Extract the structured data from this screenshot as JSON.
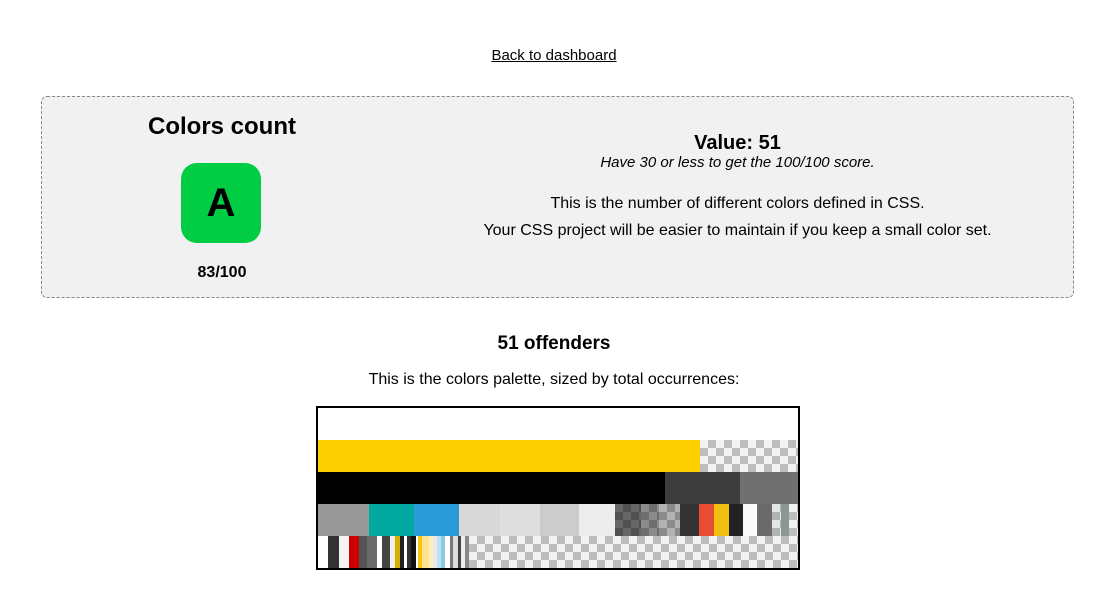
{
  "nav": {
    "back_label": "Back to dashboard"
  },
  "rule": {
    "title": "Colors count",
    "grade": "A",
    "score": "83/100",
    "grade_color": "#00cc44",
    "value_text": "Value: 51",
    "hint": "Have 30 or less to get the 100/100 score.",
    "description_line1": "This is the number of different colors defined in CSS.",
    "description_line2": "Your CSS project will be easier to maintain if you keep a small color set."
  },
  "offenders": {
    "title": "51 offenders",
    "caption": "This is the colors palette, sized by total occurrences:",
    "palette_rows": [
      [
        {
          "color": "#ffffff",
          "weight": 480
        }
      ],
      [
        {
          "color": "#ffd000",
          "weight": 382
        },
        {
          "color": "rgba(0,0,0,0.05)",
          "weight": 98,
          "transparent": true
        }
      ],
      [
        {
          "color": "#000000",
          "weight": 347
        },
        {
          "color": "#3c3c3c",
          "weight": 75
        },
        {
          "color": "#707070",
          "weight": 58
        }
      ],
      [
        {
          "color": "#999999",
          "weight": 50
        },
        {
          "color": "#00a8a0",
          "weight": 45
        },
        {
          "color": "#2a9ad8",
          "weight": 45
        },
        {
          "color": "#d8d8d8",
          "weight": 40
        },
        {
          "color": "#dedede",
          "weight": 40
        },
        {
          "color": "#cccccc",
          "weight": 38
        },
        {
          "color": "#ececec",
          "weight": 36
        },
        {
          "color": "rgba(0,0,0,0.6)",
          "weight": 26,
          "transparent": true
        },
        {
          "color": "rgba(0,0,0,0.45)",
          "weight": 18,
          "transparent": true
        },
        {
          "color": "rgba(0,0,0,0.3)",
          "weight": 20,
          "transparent": true
        },
        {
          "color": "#333333",
          "weight": 19
        },
        {
          "color": "#e94b35",
          "weight": 15
        },
        {
          "color": "#f0c010",
          "weight": 15
        },
        {
          "color": "#222222",
          "weight": 14
        },
        {
          "color": "#fafafa",
          "weight": 13
        },
        {
          "color": "#ffffff",
          "weight": 1
        },
        {
          "color": "#6a6a6a",
          "weight": 14
        },
        {
          "color": "rgba(0,0,0,0.1)",
          "weight": 9,
          "transparent": true
        },
        {
          "color": "#8a9a90",
          "weight": 8
        },
        {
          "color": "rgba(0,0,0,0.05)",
          "weight": 9,
          "transparent": true
        }
      ],
      [
        {
          "color": "#ffffff",
          "weight": 10
        },
        {
          "color": "#333333",
          "weight": 10
        },
        {
          "color": "#f4f4f4",
          "weight": 10
        },
        {
          "color": "#cc0000",
          "weight": 9
        },
        {
          "color": "#555555",
          "weight": 8
        },
        {
          "color": "#6a6a6a",
          "weight": 9
        },
        {
          "color": "#ffffff",
          "weight": 5
        },
        {
          "color": "#444444",
          "weight": 8
        },
        {
          "color": "#f0f0f0",
          "weight": 5
        },
        {
          "color": "#d4b000",
          "weight": 4
        },
        {
          "color": "#222222",
          "weight": 4
        },
        {
          "color": "#ffffff",
          "weight": 3
        },
        {
          "color": "#333333",
          "weight": 4
        },
        {
          "color": "#111111",
          "weight": 5
        },
        {
          "color": "#ffffff",
          "weight": 2
        },
        {
          "color": "#f5c518",
          "weight": 4
        },
        {
          "color": "#ffe28a",
          "weight": 5
        },
        {
          "color": "#ffeebb",
          "weight": 5
        },
        {
          "color": "#e8e8e8",
          "weight": 4
        },
        {
          "color": "#bde0f2",
          "weight": 4
        },
        {
          "color": "#8ec8e8",
          "weight": 4
        },
        {
          "color": "#ffffff",
          "weight": 4
        },
        {
          "color": "#777777",
          "weight": 3
        },
        {
          "color": "#dddddd",
          "weight": 5
        },
        {
          "color": "#444444",
          "weight": 3
        },
        {
          "color": "#eeeeee",
          "weight": 4
        },
        {
          "color": "#888888",
          "weight": 4
        },
        {
          "color": "rgba(0,0,0,0.05)",
          "weight": 314,
          "transparent": true
        }
      ]
    ]
  }
}
